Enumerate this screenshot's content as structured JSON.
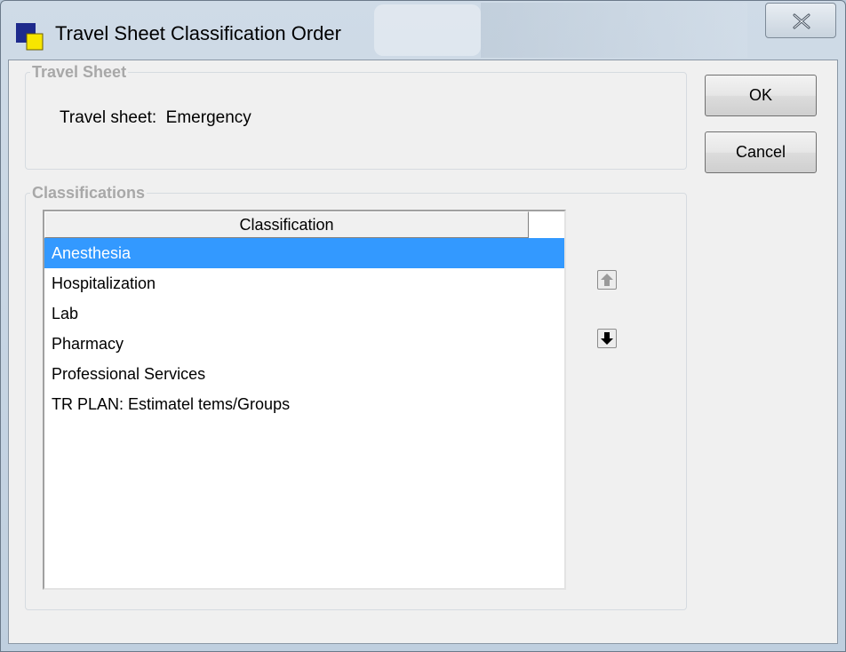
{
  "window": {
    "title": "Travel Sheet Classification Order"
  },
  "travel_sheet_group": {
    "legend": "Travel Sheet",
    "label": "Travel sheet:  Emergency"
  },
  "classifications_group": {
    "legend": "Classifications",
    "list": {
      "column_header": "Classification",
      "selected_index": 0,
      "items": [
        "Anesthesia",
        "Hospitalization",
        "Lab",
        "Pharmacy",
        "Professional Services",
        "TR PLAN: Estimatel tems/Groups"
      ]
    },
    "move_up": {
      "icon": "arrow-up-icon",
      "enabled": false
    },
    "move_down": {
      "icon": "arrow-down-icon",
      "enabled": true
    }
  },
  "buttons": {
    "ok_label": "OK",
    "cancel_label": "Cancel"
  },
  "colors": {
    "selection": "#3399ff",
    "legend_text": "#a8a8a8"
  }
}
